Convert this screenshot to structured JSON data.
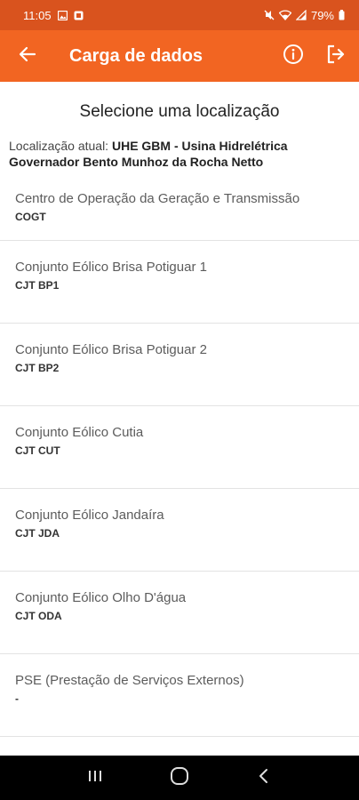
{
  "status_bar": {
    "time": "11:05",
    "battery": "79%",
    "icons": [
      "image-icon",
      "notification-icon",
      "mute-icon",
      "wifi-icon",
      "signal-icon",
      "battery-icon"
    ]
  },
  "app_bar": {
    "title": "Carga de dados",
    "back_icon": "arrow-left-icon",
    "info_icon": "info-icon",
    "logout_icon": "logout-icon",
    "background": "#f26522"
  },
  "page": {
    "title": "Selecione uma localização",
    "current_location_label": "Localização atual:",
    "current_location_value": "UHE GBM - Usina Hidrelétrica Governador Bento Munhoz da Rocha Netto"
  },
  "locations": [
    {
      "name": "Centro de Operação da Geração e Transmissão",
      "code": "COGT"
    },
    {
      "name": "Conjunto Eólico Brisa Potiguar 1",
      "code": "CJT BP1"
    },
    {
      "name": "Conjunto Eólico Brisa Potiguar 2",
      "code": "CJT BP2"
    },
    {
      "name": "Conjunto Eólico Cutia",
      "code": "CJT CUT"
    },
    {
      "name": "Conjunto Eólico Jandaíra",
      "code": "CJT JDA"
    },
    {
      "name": "Conjunto Eólico Olho D'água",
      "code": "CJT ODA"
    },
    {
      "name": "PSE (Prestação de Serviços Externos)",
      "code": "-"
    }
  ],
  "nav_bar": {
    "recent_icon": "recent-apps-icon",
    "home_icon": "home-icon",
    "back_icon": "back-icon"
  }
}
